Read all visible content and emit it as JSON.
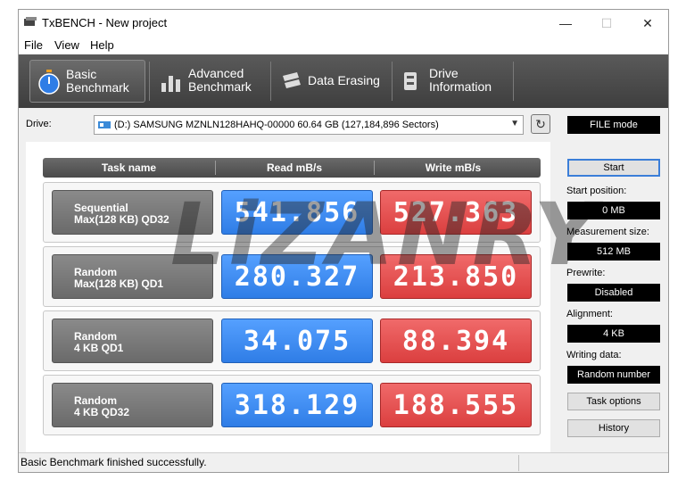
{
  "window": {
    "title": "TxBENCH - New project",
    "controls": {
      "minimize": "—",
      "maximize": "☐",
      "close": "✕"
    }
  },
  "menu": [
    "File",
    "View",
    "Help"
  ],
  "toolbar": {
    "buttons": [
      {
        "label": "Basic\nBenchmark",
        "icon": "stopwatch-icon",
        "active": true
      },
      {
        "label": "Advanced\nBenchmark",
        "icon": "bar-chart-icon",
        "active": false
      },
      {
        "label": "Data Erasing",
        "icon": "eraser-icon",
        "active": false
      },
      {
        "label": "Drive\nInformation",
        "icon": "drive-info-icon",
        "active": false
      }
    ]
  },
  "drive": {
    "label": "Drive:",
    "selected": "(D:) SAMSUNG MZNLN128HAHQ-00000  60.64 GB (127,184,896 Sectors)",
    "mode": "FILE mode"
  },
  "table": {
    "headers": [
      "Task name",
      "Read mB/s",
      "Write mB/s"
    ],
    "rows": [
      {
        "task": "Sequential\nMax(128 KB) QD32",
        "read": "541.856",
        "write": "527.363"
      },
      {
        "task": "Random\nMax(128 KB) QD1",
        "read": "280.327",
        "write": "213.850"
      },
      {
        "task": "Random\n4 KB QD1",
        "read": "34.075",
        "write": "88.394"
      },
      {
        "task": "Random\n4 KB QD32",
        "read": "318.129",
        "write": "188.555"
      }
    ]
  },
  "side_panel": {
    "start_label": "Start",
    "start_position": {
      "label": "Start position:",
      "value": "0 MB"
    },
    "measurement_size": {
      "label": "Measurement size:",
      "value": "512 MB"
    },
    "prewrite": {
      "label": "Prewrite:",
      "value": "Disabled"
    },
    "alignment": {
      "label": "Alignment:",
      "value": "4 KB"
    },
    "writing_data": {
      "label": "Writing data:",
      "value": "Random number"
    },
    "task_options_label": "Task options",
    "history_label": "History"
  },
  "status": "Basic Benchmark finished successfully.",
  "watermark": "LiZANRY",
  "colors": {
    "read": "#3b87f0",
    "write": "#e24c4c",
    "toolbar": "#4a4a4a"
  }
}
